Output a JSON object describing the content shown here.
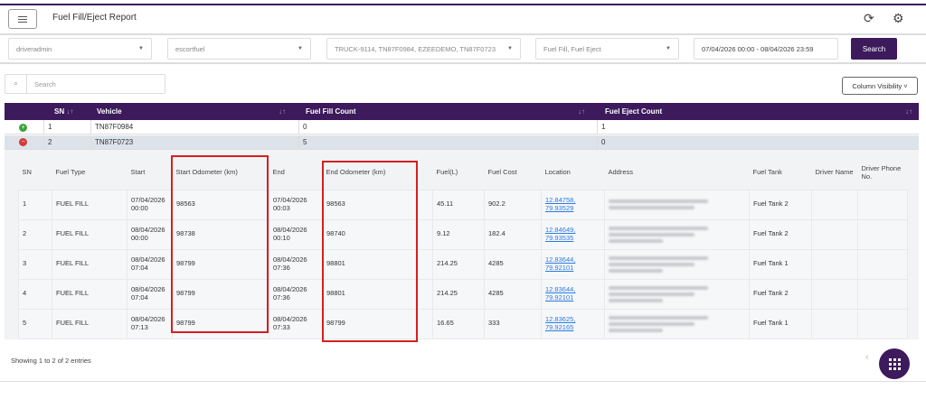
{
  "header": {
    "title": "Fuel Fill/Eject Report",
    "icons": [
      "menu-icon",
      "refresh-icon",
      "gear-icon"
    ]
  },
  "filters": {
    "user": "driveradmin",
    "group": "escortfuel",
    "vehicles": "TRUCK-9114, TN87F0984, EZEEDEMO, TN87F0723",
    "type": "Fuel Fill, Fuel Eject",
    "daterange": "07/04/2026 00:00 - 08/04/2026 23:59",
    "search_label": "Search"
  },
  "table_tools": {
    "search_placeholder": "Search",
    "column_visibility": "Column Visibility"
  },
  "main": {
    "headers": [
      "SN",
      "Vehicle",
      "Fuel Fill Count",
      "Fuel Eject Count"
    ],
    "rows": [
      {
        "sn": "1",
        "vehicle": "TN87F0984",
        "fill": "0",
        "eject": "1",
        "expanded": false
      },
      {
        "sn": "2",
        "vehicle": "TN87F0723",
        "fill": "5",
        "eject": "0",
        "expanded": true
      }
    ]
  },
  "detail": {
    "headers": [
      "SN",
      "Fuel Type",
      "Start",
      "Start Odometer (km)",
      "End",
      "End Odometer (km)",
      "Fuel(L)",
      "Fuel Cost",
      "Location",
      "Address",
      "Fuel Tank",
      "Driver Name",
      "Driver Phone No."
    ],
    "rows": [
      {
        "sn": "1",
        "type": "FUEL FILL",
        "start": "07/04/2026 00:00",
        "start_odo": "98563",
        "end": "07/04/2026 00:03",
        "end_odo": "98563",
        "fuel": "45.11",
        "cost": "902.2",
        "loc1": "12.84758,",
        "loc2": "79.93529",
        "tank": "Fuel Tank 2"
      },
      {
        "sn": "2",
        "type": "FUEL FILL",
        "start": "08/04/2026 00:00",
        "start_odo": "98738",
        "end": "08/04/2026 00:10",
        "end_odo": "98740",
        "fuel": "9.12",
        "cost": "182.4",
        "loc1": "12.84649,",
        "loc2": "79.93535",
        "tank": "Fuel Tank 2"
      },
      {
        "sn": "3",
        "type": "FUEL FILL",
        "start": "08/04/2026 07:04",
        "start_odo": "98799",
        "end": "08/04/2026 07:36",
        "end_odo": "98801",
        "fuel": "214.25",
        "cost": "4285",
        "loc1": "12.83644,",
        "loc2": "79.92101",
        "tank": "Fuel Tank 1"
      },
      {
        "sn": "4",
        "type": "FUEL FILL",
        "start": "08/04/2026 07:04",
        "start_odo": "98799",
        "end": "08/04/2026 07:36",
        "end_odo": "98801",
        "fuel": "214.25",
        "cost": "4285",
        "loc1": "12.83644,",
        "loc2": "79.92101",
        "tank": "Fuel Tank 2"
      },
      {
        "sn": "5",
        "type": "FUEL FILL",
        "start": "08/04/2026 07:13",
        "start_odo": "98799",
        "end": "08/04/2026 07:33",
        "end_odo": "98799",
        "fuel": "16.65",
        "cost": "333",
        "loc1": "12.83625,",
        "loc2": "79.92165",
        "tank": "Fuel Tank 1"
      }
    ]
  },
  "footer": {
    "info": "Showing 1 to 2 of 2 entries",
    "prev": "‹"
  },
  "colors": {
    "brand": "#3d1a5b",
    "highlight": "#d42020",
    "link": "#2a7ae2"
  }
}
